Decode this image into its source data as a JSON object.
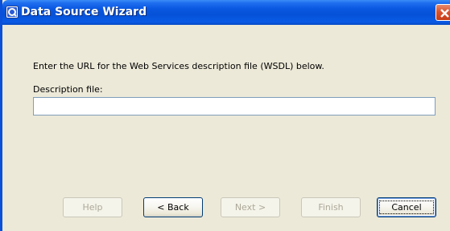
{
  "window": {
    "title": "Data Source Wizard",
    "title_icon": "app-icon",
    "close_icon": "close-icon"
  },
  "content": {
    "instruction": "Enter the URL for the Web Services description file (WSDL) below.",
    "field_label": "Description file:",
    "field_value": "",
    "field_placeholder": ""
  },
  "buttons": {
    "help": "Help",
    "back": "< Back",
    "next": "Next >",
    "finish": "Finish",
    "cancel": "Cancel"
  },
  "colors": {
    "titlebar": "#0552d8",
    "dialog_bg": "#ece9d8",
    "close_button": "#d9532e",
    "input_border": "#7f9db9",
    "disabled_text": "#aca899"
  }
}
